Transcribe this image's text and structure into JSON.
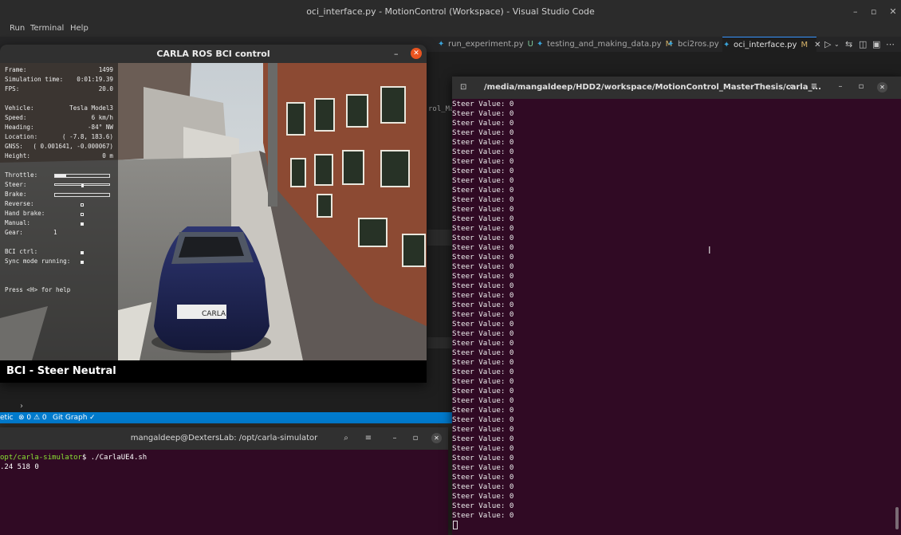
{
  "vscode": {
    "title": "oci_interface.py - MotionControl (Workspace) - Visual Studio Code",
    "menu": [
      "Run",
      "Terminal",
      "Help"
    ],
    "tabs": [
      {
        "label": "run_experiment.py",
        "mark": "U",
        "active": false
      },
      {
        "label": "testing_and_making_data.py",
        "mark": "M",
        "active": false
      },
      {
        "label": "bci2ros.py",
        "mark": "",
        "active": false
      },
      {
        "label": "oci_interface.py",
        "mark": "M",
        "active": true
      }
    ],
    "partial_text": "rol_Ma",
    "status": {
      "left": "etic",
      "problems": "⊗ 0 ⚠ 0",
      "git": "Git Graph",
      "check": "✓"
    }
  },
  "carla": {
    "title": "CARLA ROS BCI control",
    "hud": {
      "frame_label": "Frame:",
      "frame": "1499",
      "sim_time_label": "Simulation time:",
      "sim_time": "0:01:19.39",
      "fps_label": "FPS:",
      "fps": "20.0",
      "vehicle_label": "Vehicle:",
      "vehicle": "Tesla Model3",
      "speed_label": "Speed:",
      "speed": "6 km/h",
      "heading_label": "Heading:",
      "heading": "-84° NW",
      "location_label": "Location:",
      "location": "( -7.8, 183.6)",
      "gnss_label": "GNSS:",
      "gnss": "( 0.001641, -0.000067)",
      "height_label": "Height:",
      "height": "0 m",
      "throttle_label": "Throttle:",
      "throttle": 0.2,
      "steer_label": "Steer:",
      "steer": 0.0,
      "brake_label": "Brake:",
      "brake": 0.0,
      "reverse_label": "Reverse:",
      "reverse": false,
      "handbrake_label": "Hand brake:",
      "handbrake": false,
      "manual_label": "Manual:",
      "manual": true,
      "gear_label": "Gear:",
      "gear": "1",
      "bci_label": "BCI ctrl:",
      "bci": true,
      "sync_label": "Sync mode running:",
      "sync": true,
      "help": "Press <H> for help"
    },
    "plate": "CARLA",
    "footer": "BCI - Steer Neutral"
  },
  "terminal_bottom": {
    "title": "mangaldeep@DextersLab: /opt/carla-simulator",
    "prompt_path": "opt/carla-simulator",
    "command": "$ ./CarlaUE4.sh",
    "output": ".24 518 0"
  },
  "terminal_right": {
    "title": "/media/mangaldeep/HDD2/workspace/MotionControl_MasterThesis/carla_...",
    "line": "Steer Value: 0",
    "line_count": 44
  }
}
